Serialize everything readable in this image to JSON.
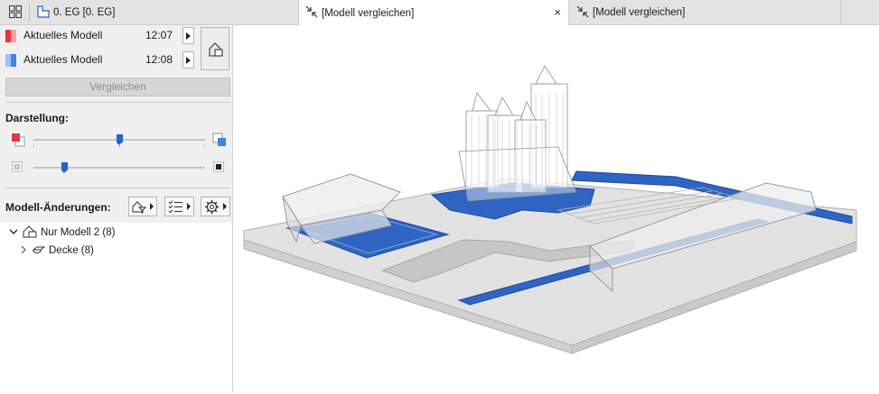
{
  "tabs": {
    "story": "0. EG [0. EG]",
    "active": "[Modell vergleichen]",
    "secondary": "[Modell vergleichen]",
    "close_glyph": "×"
  },
  "models": [
    {
      "name": "Aktuelles Modell",
      "time": "12:07",
      "color": "#e8353a"
    },
    {
      "name": "Aktuelles Modell",
      "time": "12:08",
      "color": "#3b86e8"
    }
  ],
  "compare_button": "Vergleichen",
  "display": {
    "label": "Darstellung:",
    "slider_1_value": 0.5,
    "slider_2_value": 0.18
  },
  "changes": {
    "label": "Modell-Änderungen:",
    "tree": [
      {
        "label": "Nur Modell 2 (8)",
        "expanded": true
      },
      {
        "label": "Decke (8)",
        "expanded": false
      }
    ]
  },
  "colors": {
    "accent": "#1e66c8",
    "model_fill": "#2f64c2"
  }
}
